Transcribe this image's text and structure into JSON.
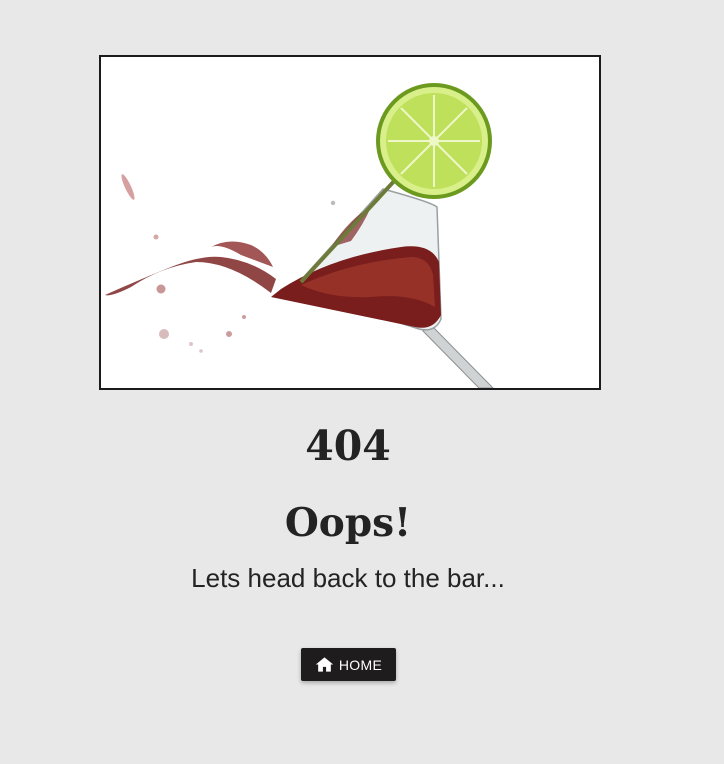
{
  "hero": {
    "image_description_icon": "martini-glass-splash-with-lime-icon"
  },
  "error": {
    "code": "404",
    "title": "Oops!",
    "message": "Lets head back to the bar..."
  },
  "home_button": {
    "label": "HOME",
    "icon": "home-icon"
  },
  "colors": {
    "background": "#e9e8e9",
    "text": "#232323",
    "button_bg": "#1e1c1d",
    "button_text": "#ffffff",
    "wine": "#7a1d1d",
    "lime": "#a8cf3f"
  }
}
